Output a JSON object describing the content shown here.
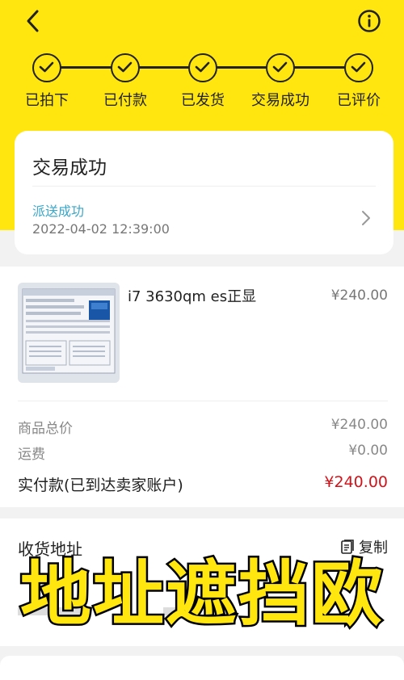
{
  "nav": {
    "back_icon": "chevron-left-icon",
    "info_icon": "info-icon"
  },
  "progress": {
    "steps": [
      {
        "label": "已拍下",
        "done": true
      },
      {
        "label": "已付款",
        "done": true
      },
      {
        "label": "已发货",
        "done": true
      },
      {
        "label": "交易成功",
        "done": true
      },
      {
        "label": "已评价",
        "done": true
      }
    ]
  },
  "status": {
    "title": "交易成功",
    "delivery_status": "派送成功",
    "delivery_time": "2022-04-02 12:39:00"
  },
  "order": {
    "product_name": "i7 3630qm es正显",
    "product_price": "¥240.00",
    "subtotal_label": "商品总价",
    "subtotal_value": "¥240.00",
    "shipping_label": "运费",
    "shipping_value": "¥0.00",
    "total_label": "实付款(已到达卖家账户)",
    "total_value": "¥240.00"
  },
  "address": {
    "title": "收货地址",
    "copy_label": "复制"
  },
  "overlay": {
    "text": "地址遮挡欧"
  },
  "colors": {
    "brand_yellow": "#ffe60f",
    "price_red": "#d0141b",
    "link_blue": "#3aa6c8"
  }
}
